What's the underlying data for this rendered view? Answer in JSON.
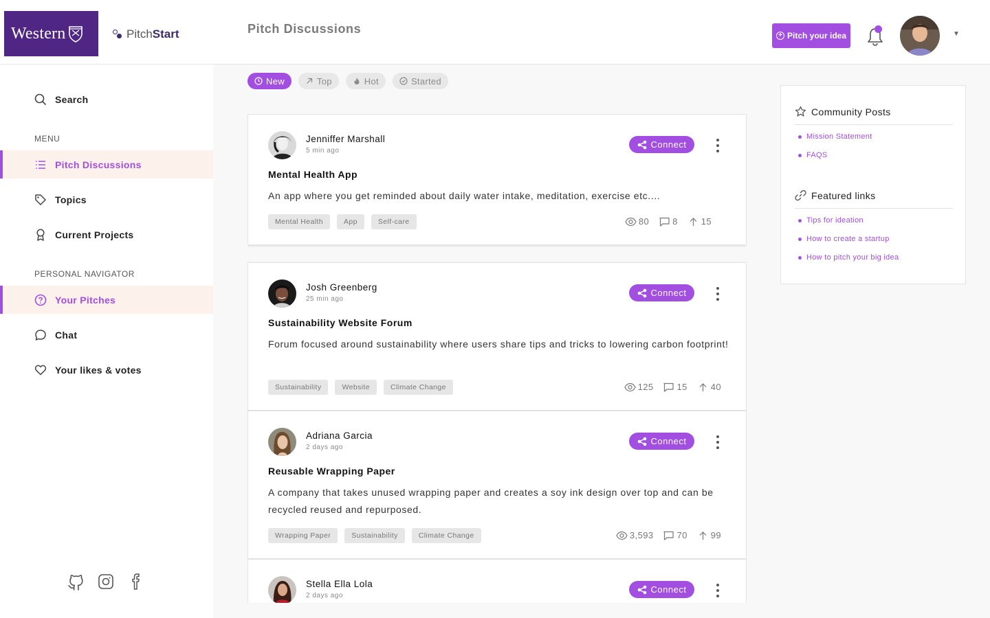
{
  "header": {
    "logo_text": "Western",
    "brand_light": "Pitch",
    "brand_bold": "Start",
    "page_title": "Pitch Discussions",
    "pitch_button": "Pitch your idea"
  },
  "sidebar": {
    "search": "Search",
    "menu_label": "MENU",
    "menu_items": [
      "Pitch Discussions",
      "Topics",
      "Current Projects"
    ],
    "personal_label": "PERSONAL NAVIGATOR",
    "personal_items": [
      "Your Pitches",
      "Chat",
      "Your likes & votes"
    ]
  },
  "filters": [
    "New",
    "Top",
    "Hot",
    "Started"
  ],
  "posts": [
    {
      "name": "Jenniffer Marshall",
      "time": "5 min ago",
      "title": "Mental Health App",
      "description": "An app where you get reminded about daily water intake, meditation, exercise etc....",
      "tags": [
        "Mental Health",
        "App",
        "Self-care"
      ],
      "views": "80",
      "comments": "8",
      "votes": "15",
      "connect": "Connect"
    },
    {
      "name": "Josh Greenberg",
      "time": "25 min ago",
      "title": "Sustainability Website Forum",
      "description": "Forum focused around sustainability where users share tips and tricks to lowering carbon footprint!",
      "tags": [
        "Sustainability",
        "Website",
        "Climate Change"
      ],
      "views": "125",
      "comments": "15",
      "votes": "40",
      "connect": "Connect"
    },
    {
      "name": "Adriana Garcia",
      "time": "2 days ago",
      "title": "Reusable Wrapping Paper",
      "description": "A company that takes unused wrapping paper and creates a soy ink  design over top and can be recycled reused and repurposed.",
      "tags": [
        "Wrapping Paper",
        "Sustainability",
        "Climate Change"
      ],
      "views": "3,593",
      "comments": "70",
      "votes": "99",
      "connect": "Connect"
    },
    {
      "name": "Stella Ella Lola",
      "time": "2 days ago",
      "connect": "Connect"
    }
  ],
  "right_panel": {
    "community_title": "Community Posts",
    "community_links": [
      "Mission Statement",
      "FAQS"
    ],
    "featured_title": "Featured links",
    "featured_links": [
      "Tips for ideation",
      "How to create a startup",
      "How to pitch your big idea"
    ]
  },
  "colors": {
    "accent": "#a24ee0",
    "brand_purple": "#4f2683",
    "active_bg": "#fdf1ec"
  },
  "icons": [
    "search-icon",
    "list-icon",
    "tag-icon",
    "award-icon",
    "question-circle-icon",
    "chat-icon",
    "heart-icon",
    "github-icon",
    "instagram-icon",
    "facebook-icon",
    "bell-icon",
    "share-icon",
    "eye-icon",
    "comment-icon",
    "arrow-up-icon",
    "star-icon",
    "link-icon"
  ]
}
